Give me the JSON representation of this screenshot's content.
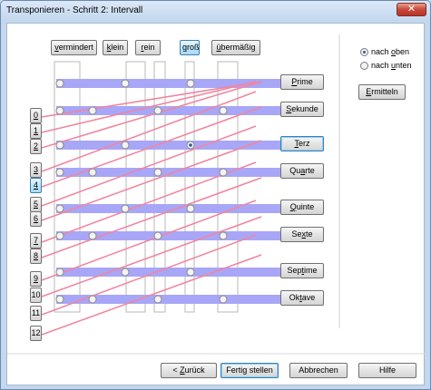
{
  "window": {
    "title": "Transponieren  -  Schritt 2: Intervall",
    "close_label": "✕"
  },
  "quality_buttons": [
    {
      "label": "vermindert",
      "pre": "",
      "key": "v",
      "post": "ermindert",
      "active": false
    },
    {
      "label": "klein",
      "pre": "",
      "key": "k",
      "post": "lein",
      "active": false
    },
    {
      "label": "rein",
      "pre": "",
      "key": "r",
      "post": "ein",
      "active": false
    },
    {
      "label": "groß",
      "pre": "",
      "key": "g",
      "post": "roß",
      "active": true
    },
    {
      "label": "übermäßig",
      "pre": "",
      "key": "ü",
      "post": "bermäßig",
      "active": false
    }
  ],
  "intervals": [
    {
      "label": "Prime",
      "pre": "",
      "key": "P",
      "post": "rime",
      "selected": false
    },
    {
      "label": "Sekunde",
      "pre": "",
      "key": "S",
      "post": "ekunde",
      "selected": false
    },
    {
      "label": "Terz",
      "pre": "",
      "key": "T",
      "post": "erz",
      "selected": true
    },
    {
      "label": "Quarte",
      "pre": "Qu",
      "key": "a",
      "post": "rte",
      "selected": false
    },
    {
      "label": "Quinte",
      "pre": "",
      "key": "Q",
      "post": "uinte",
      "selected": false
    },
    {
      "label": "Sexte",
      "pre": "Se",
      "key": "x",
      "post": "te",
      "selected": false
    },
    {
      "label": "Septime",
      "pre": "Sep",
      "key": "t",
      "post": "ime",
      "selected": false
    },
    {
      "label": "Oktave",
      "pre": "Ok",
      "key": "t",
      "post": "ave",
      "selected": false
    }
  ],
  "semitones": [
    "0",
    "1",
    "2",
    "3",
    "4",
    "5",
    "6",
    "7",
    "8",
    "9",
    "10",
    "11",
    "12"
  ],
  "semitone_keys": [
    "0",
    "1",
    "2",
    "3",
    "4",
    "5",
    "6",
    "7",
    "8",
    "9",
    "",
    "",
    ""
  ],
  "semitone_selected": "4",
  "direction": {
    "up_label": "nach oben",
    "up_pre": "nach ",
    "up_key": "o",
    "up_post": "ben",
    "down_label": "nach unten",
    "down_pre": "nach ",
    "down_key": "u",
    "down_post": "nten",
    "selected": "up"
  },
  "determine_label": "Ermitteln",
  "determine_pre": "",
  "determine_key": "E",
  "determine_post": "rmitteln",
  "footer": {
    "back_label": "< Zurück",
    "back_pre": "< ",
    "back_key": "Z",
    "back_post": "urück",
    "finish_label": "Fertig stellen",
    "cancel_label": "Abbrechen",
    "help_label": "Hilfe"
  },
  "colors": {
    "row_band": "#a8a6f7",
    "line": "#f0869f",
    "accent": "#3c7fb1"
  }
}
